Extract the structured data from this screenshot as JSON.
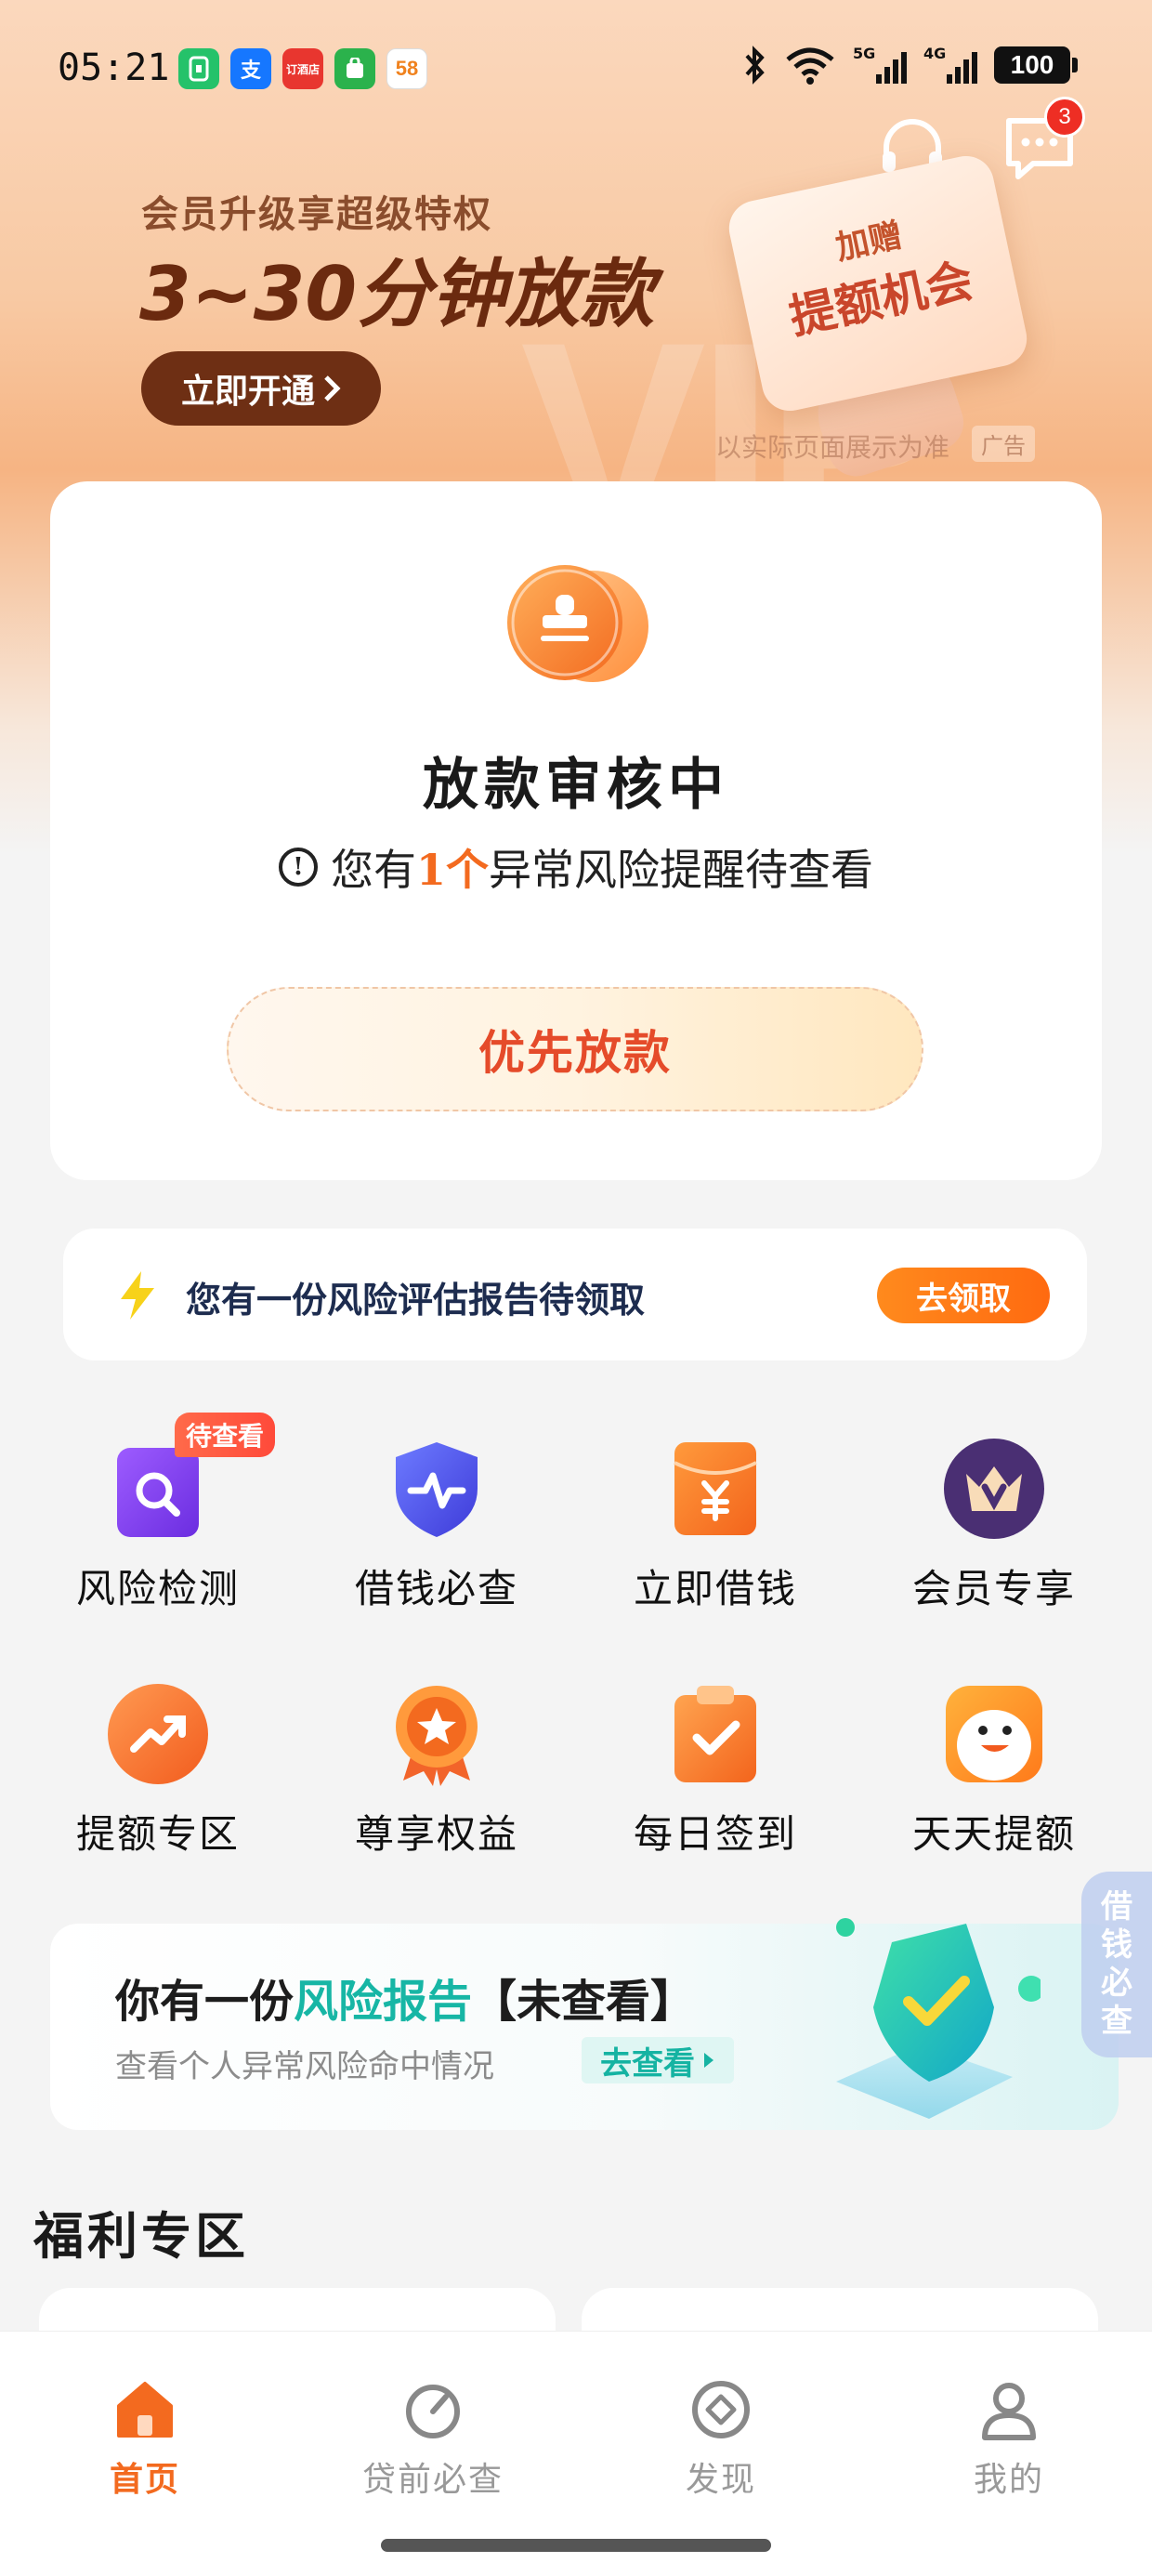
{
  "status_bar": {
    "time": "05:21",
    "battery": "100",
    "signal_1": "5G",
    "signal_2": "4G",
    "app_icons": [
      "green-phone-app",
      "alipay-app",
      "store-app",
      "green-shop-app",
      "58-app"
    ],
    "alipay_glyph": "支",
    "store_glyph": "订酒店",
    "app58_glyph": "58"
  },
  "header": {
    "message_badge": "3"
  },
  "banner": {
    "subtitle": "会员升级享超级特权",
    "title": "3~30分钟放款",
    "button_label": "立即开通",
    "card_line1": "加赠",
    "card_line2": "提额机会",
    "note": "以实际页面展示为准",
    "ad_tag": "广告"
  },
  "status_card": {
    "title": "放款审核中",
    "warn_prefix": "您有",
    "warn_count": "1个",
    "warn_suffix": "异常风险提醒待查看",
    "button_label": "优先放款"
  },
  "report_strip": {
    "text": "您有一份风险评估报告待领取",
    "button_label": "去领取"
  },
  "grid": {
    "items": [
      {
        "label": "风险检测",
        "icon": "search-doc-icon",
        "tag": "待查看"
      },
      {
        "label": "借钱必查",
        "icon": "pulse-shield-icon"
      },
      {
        "label": "立即借钱",
        "icon": "yen-envelope-icon"
      },
      {
        "label": "会员专享",
        "icon": "vip-crown-icon"
      },
      {
        "label": "提额专区",
        "icon": "trend-up-icon"
      },
      {
        "label": "尊享权益",
        "icon": "medal-icon"
      },
      {
        "label": "每日签到",
        "icon": "checkin-clipboard-icon"
      },
      {
        "label": "天天提额",
        "icon": "duck-mascot-icon"
      }
    ]
  },
  "side_tab": {
    "line1": "借",
    "line2": "钱",
    "line3": "必",
    "line4": "查"
  },
  "risk_banner": {
    "title_prefix": "你有一份",
    "title_highlight": "风险报告",
    "title_suffix": "【未查看】",
    "subtitle": "查看个人异常风险命中情况",
    "link_label": "去查看"
  },
  "welfare": {
    "title": "福利专区"
  },
  "tab_bar": {
    "tabs": [
      {
        "label": "首页",
        "icon": "home-icon",
        "active": true
      },
      {
        "label": "贷前必查",
        "icon": "gauge-icon",
        "active": false
      },
      {
        "label": "发现",
        "icon": "discover-icon",
        "active": false
      },
      {
        "label": "我的",
        "icon": "profile-icon",
        "active": false
      }
    ]
  },
  "colors": {
    "accent_orange": "#f36a1f",
    "teal": "#17b6a5",
    "banner_brown": "#6e2f14"
  }
}
